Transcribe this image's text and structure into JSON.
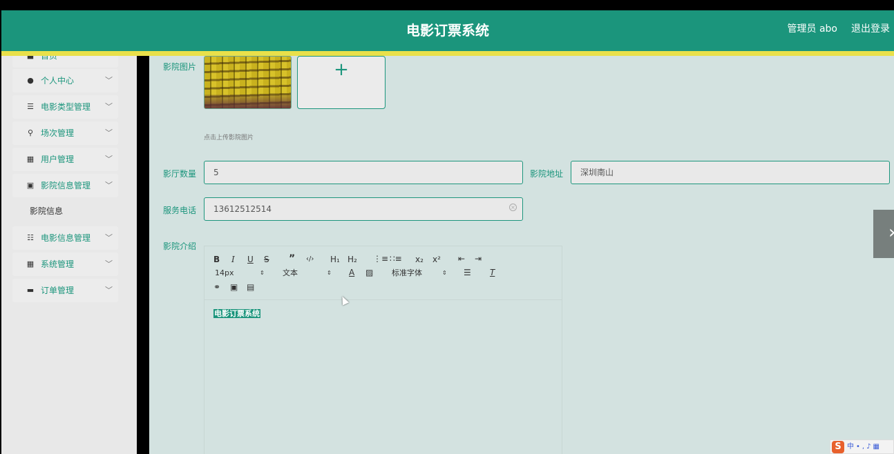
{
  "header": {
    "title": "电影订票系统",
    "admin_label": "管理员 abo",
    "logout_label": "退出登录"
  },
  "sidebar": {
    "items": [
      {
        "label": "首页",
        "icon": "home-icon"
      },
      {
        "label": "个人中心",
        "icon": "person-icon"
      },
      {
        "label": "电影类型管理",
        "icon": "list-icon"
      },
      {
        "label": "场次管理",
        "icon": "stamp-icon"
      },
      {
        "label": "用户管理",
        "icon": "grid-icon"
      },
      {
        "label": "影院信息管理",
        "icon": "clipboard-icon"
      },
      {
        "label": "影院信息",
        "icon": ""
      },
      {
        "label": "电影信息管理",
        "icon": "sliders-icon"
      },
      {
        "label": "系统管理",
        "icon": "grid-icon"
      },
      {
        "label": "订单管理",
        "icon": "monitor-icon"
      }
    ]
  },
  "form": {
    "image_label": "影院图片",
    "upload_plus": "+",
    "upload_hint": "点击上传影院图片",
    "hall_count_label": "影厅数量",
    "hall_count_value": "5",
    "address_label": "影院地址",
    "address_value": "深圳南山",
    "phone_label": "服务电话",
    "phone_value": "13612512514",
    "intro_label": "影院介绍"
  },
  "editor": {
    "font_size": "14px",
    "text_type": "文本",
    "font_family": "标准字体",
    "content": "电影订票系统"
  },
  "colors": {
    "primary": "#1b957c",
    "accent_line": "#e9e04a",
    "content_bg": "#d3e2e0"
  }
}
